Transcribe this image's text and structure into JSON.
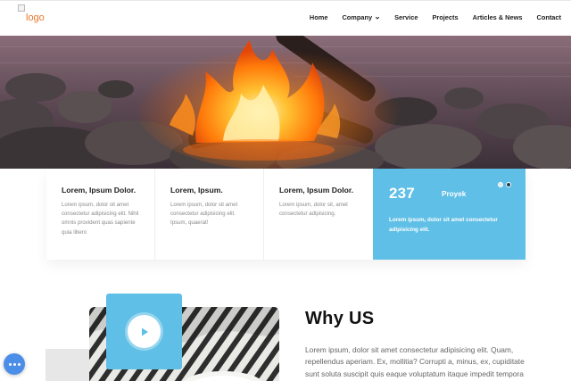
{
  "header": {
    "logo_alt": "logo",
    "nav": [
      {
        "label": "Home",
        "has_dropdown": false
      },
      {
        "label": "Company",
        "has_dropdown": true
      },
      {
        "label": "Service",
        "has_dropdown": false
      },
      {
        "label": "Projects",
        "has_dropdown": false
      },
      {
        "label": "Articles & News",
        "has_dropdown": false
      },
      {
        "label": "Contact",
        "has_dropdown": false
      }
    ]
  },
  "features": [
    {
      "title": "Lorem, Ipsum Dolor.",
      "text": "Lorem ipsum, dolor sit amet consectetur adipisicing elit. Nihil omnis provident quas sapiente quia libero"
    },
    {
      "title": "Lorem, Ipsum.",
      "text": "Lorem ipsum, dolor sit amet consectetur adipisicing elit. Ipsum, quaerat!"
    },
    {
      "title": "Lorem, Ipsum Dolor.",
      "text": "Lorem ipsum, dolor sit, amet consectetur adipisicing."
    }
  ],
  "stat": {
    "number": "237",
    "label": "Proyek",
    "text": "Lorem ipsum, dolor sit amet consectetur adipisicing elit."
  },
  "why": {
    "title": "Why US",
    "text": "Lorem ipsum, dolor sit amet consectetur adipisicing elit. Quam, repellendus aperiam. Ex, mollitia? Corrupti a, minus, ex, cupiditate sunt soluta suscipit quis eaque voluptatum itaque impedit tempora"
  },
  "colors": {
    "accent_blue": "#5fbfe6",
    "logo_orange": "#e8772e",
    "fab_blue": "#4b8ee8"
  },
  "icons": {
    "play": "play-icon",
    "chevron": "chevron-down-icon",
    "fab": "more-dots-icon"
  }
}
